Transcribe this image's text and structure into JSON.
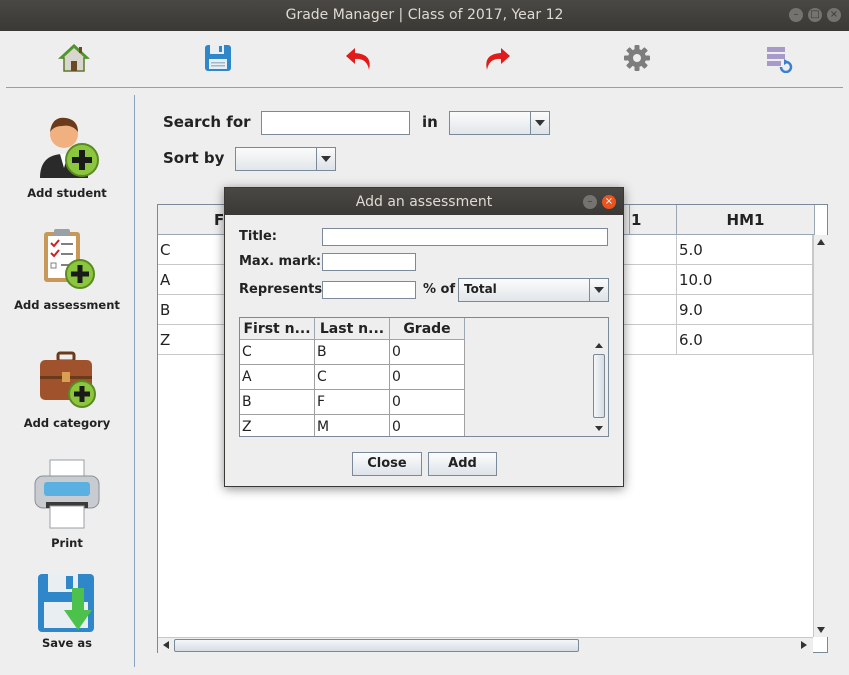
{
  "window": {
    "title": "Grade Manager | Class of 2017, Year 12"
  },
  "toolbar": {
    "icons": [
      "home-icon",
      "save-icon",
      "undo-icon",
      "redo-icon",
      "settings-icon",
      "refresh-list-icon"
    ]
  },
  "sidebar": {
    "items": [
      {
        "label": "Add student",
        "icon": "add-student-icon"
      },
      {
        "label": "Add assessment",
        "icon": "add-assessment-icon"
      },
      {
        "label": "Add category",
        "icon": "add-category-icon"
      },
      {
        "label": "Print",
        "icon": "printer-icon"
      },
      {
        "label": "Save as",
        "icon": "save-as-icon"
      }
    ]
  },
  "search": {
    "search_label": "Search for",
    "in_label": "in",
    "sort_label": "Sort by",
    "search_value": "",
    "in_value": "",
    "sort_value": ""
  },
  "main_table": {
    "columns": [
      "F",
      "HM1"
    ],
    "rows": [
      {
        "first": "C",
        "hm1": "5.0"
      },
      {
        "first": "A",
        "hm1": "10.0"
      },
      {
        "first": "B",
        "hm1": "9.0"
      },
      {
        "first": "Z",
        "hm1": "6.0"
      }
    ],
    "hidden_header_fragment": "1"
  },
  "dialog": {
    "title": "Add an assessment",
    "title_label": "Title:",
    "max_mark_label": "Max. mark:",
    "represents_label": "Represents",
    "percent_of_label": "% of",
    "percent_of_value": "Total",
    "title_value": "",
    "max_mark_value": "",
    "represents_value": "",
    "table": {
      "columns": [
        "First n...",
        "Last n...",
        "Grade"
      ],
      "rows": [
        {
          "first": "C",
          "last": "B",
          "grade": "0"
        },
        {
          "first": "A",
          "last": "C",
          "grade": "0"
        },
        {
          "first": "B",
          "last": "F",
          "grade": "0"
        },
        {
          "first": "Z",
          "last": "M",
          "grade": "0"
        }
      ]
    },
    "close_label": "Close",
    "add_label": "Add"
  },
  "colors": {
    "accent": "#8aa1c2",
    "titlebar": "#3b3935",
    "close": "#e95420"
  }
}
